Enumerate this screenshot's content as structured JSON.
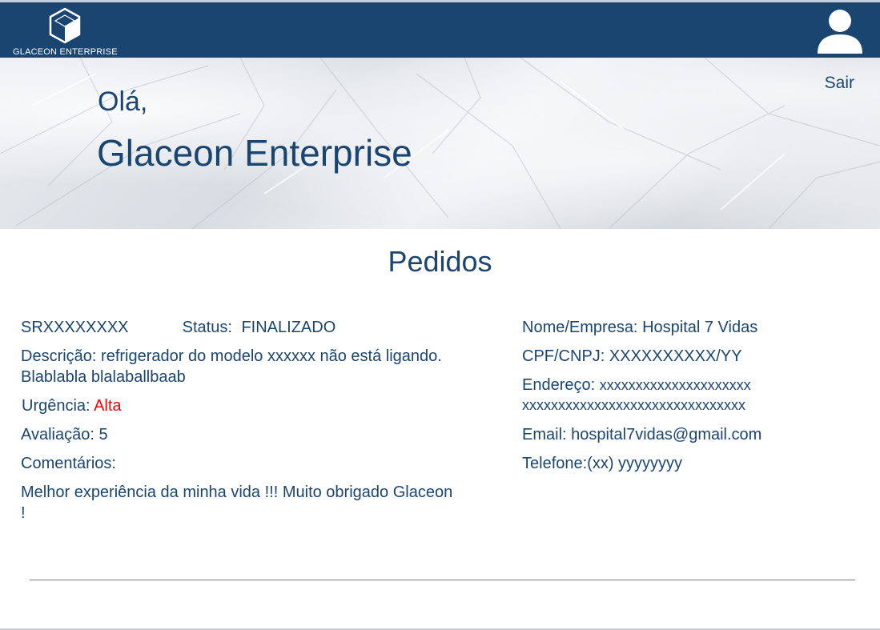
{
  "header": {
    "logo_text": "GLACEON ENTERPRISE",
    "brand_color": "#1b4571",
    "user_icon": "user-avatar-icon"
  },
  "hero": {
    "greeting": "Olá,",
    "company_name": "Glaceon Enterprise",
    "logout_label": "Sair"
  },
  "orders": {
    "title": "Pedidos",
    "order_id": "SRXXXXXXXX",
    "status_label": "Status:",
    "status_value": "FINALIZADO",
    "description_label": "Descrição:",
    "description_value": "refrigerador do modelo xxxxxx não está ligando. Blablabla blalaballbaab",
    "urgency_label": "Urgência:",
    "urgency_value": "Alta",
    "urgency_color": "#ff0000",
    "rating_label": "Avaliação:",
    "rating_value": "5",
    "comments_label": "Comentários:",
    "comments_value": "Melhor experiência da minha vida !!! Muito obrigado Glaceon !",
    "client_name_label": "Nome/Empresa:",
    "client_name_value": "Hospital 7 Vidas",
    "document_label": "CPF/CNPJ:",
    "document_value": "XXXXXXXXXX/YY",
    "address_label": "Endereço:",
    "address_line1": "xxxxxxxxxxxxxxxxxxxxx",
    "address_line2": "xxxxxxxxxxxxxxxxxxxxxxxxxxxxxxx",
    "email_label": "Email:",
    "email_value": "hospital7vidas@gmail.com",
    "phone_label": "Telefone:",
    "phone_value": "(xx) yyyyyyyy"
  }
}
